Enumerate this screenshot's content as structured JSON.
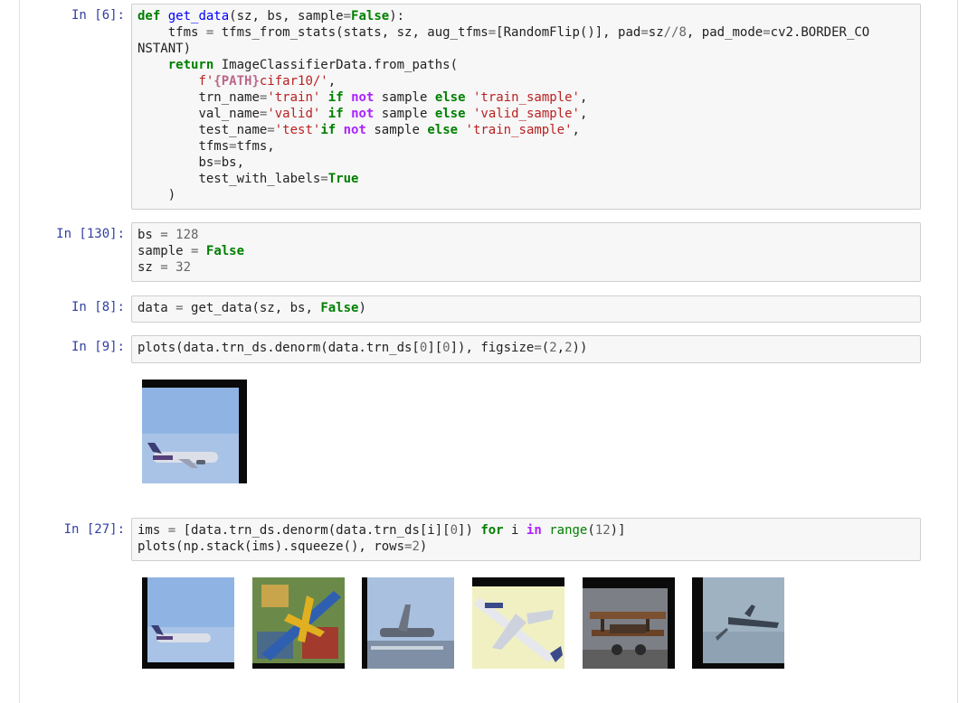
{
  "cells": [
    {
      "prompt": "In [6]:"
    },
    {
      "prompt": "In [130]:"
    },
    {
      "prompt": "In [8]:"
    },
    {
      "prompt": "In [9]:"
    },
    {
      "prompt": "In [27]:"
    }
  ],
  "code": {
    "c6_l1_def": "def",
    "c6_l1_fn": "get_data",
    "c6_l1_rest1": "(sz, bs, sample",
    "c6_l1_eq": "=",
    "c6_l1_false": "False",
    "c6_l1_rest2": "):",
    "c6_l2a": "    tfms ",
    "c6_l2b": "=",
    "c6_l2c": " tfms_from_stats(stats, sz, aug_tfms",
    "c6_l2d": "=",
    "c6_l2e": "[RandomFlip()], pad",
    "c6_l2f": "=",
    "c6_l2g": "sz",
    "c6_l2h": "//",
    "c6_l2i": "8",
    "c6_l2j": ", pad_mode",
    "c6_l2k": "=",
    "c6_l2l": "cv2.BORDER_CO",
    "c6_l3": "NSTANT)",
    "c6_l4_ret": "return",
    "c6_l4_rest": " ImageClassifierData.from_paths(",
    "c6_l5a": "f'",
    "c6_l5b": "{PATH}",
    "c6_l5c": "cifar10/'",
    "c6_l5d": ",",
    "c6_l6a": "trn_name",
    "c6_l6eq": "=",
    "c6_l6s1": "'train'",
    "c6_l6if": "if",
    "c6_l6not": "not",
    "c6_l6mid": "sample",
    "c6_l6else": "else",
    "c6_l6s2": "'train_sample'",
    "c6_l7a": "val_name",
    "c6_l7eq": "=",
    "c6_l7s1": "'valid'",
    "c6_l7if": "if",
    "c6_l7not": "not",
    "c6_l7mid": "sample",
    "c6_l7else": "else",
    "c6_l7s2": "'valid_sample'",
    "c6_l8a": "test_name",
    "c6_l8eq": "=",
    "c6_l8s1": "'test'",
    "c6_l8if": "if",
    "c6_l8not": "not",
    "c6_l8mid": "sample",
    "c6_l8else": "else",
    "c6_l8s2": "'train_sample'",
    "c6_l9a": "tfms",
    "c6_l9eq": "=",
    "c6_l9b": "tfms,",
    "c6_l10a": "bs",
    "c6_l10eq": "=",
    "c6_l10b": "bs,",
    "c6_l11a": "test_with_labels",
    "c6_l11eq": "=",
    "c6_l11b": "True",
    "c6_l12": ")",
    "c130_l1a": "bs ",
    "c130_l1eq": "=",
    "c130_l1num": " 128",
    "c130_l2a": "sample ",
    "c130_l2eq": "=",
    "c130_l2b": "False",
    "c130_l3a": "sz ",
    "c130_l3eq": "=",
    "c130_l3num": " 32",
    "c8a": "data ",
    "c8eq": "=",
    "c8b": " get_data(sz, bs, ",
    "c8c": "False",
    "c8d": ")",
    "c9a": "plots(data.trn_ds.denorm(data.trn_ds[",
    "c9n1": "0",
    "c9b": "][",
    "c9n2": "0",
    "c9c": "]), figsize",
    "c9eq": "=",
    "c9d": "(",
    "c9n3": "2",
    "c9e": ",",
    "c9n4": "2",
    "c9f": "))",
    "c27_l1a": "ims ",
    "c27_l1eq": "=",
    "c27_l1b": " [data.trn_ds.denorm(data.trn_ds[i][",
    "c27_l1n": "0",
    "c27_l1c": "]) ",
    "c27_l1for": "for",
    "c27_l1d": " i ",
    "c27_l1in": "in",
    "c27_l1e": " ",
    "c27_l1range": "range",
    "c27_l1f": "(",
    "c27_l1n2": "12",
    "c27_l1g": ")]",
    "c27_l2a": "plots(np.stack(ims).squeeze(), rows",
    "c27_l2eq": "=",
    "c27_l2n": "2",
    "c27_l2b": ")"
  },
  "outputs": {
    "single_image": "airplane-thumbnail",
    "grid_images": [
      "airplane-1",
      "airplane-2",
      "airplane-3",
      "airplane-4",
      "biplane-5",
      "airplane-6"
    ]
  }
}
